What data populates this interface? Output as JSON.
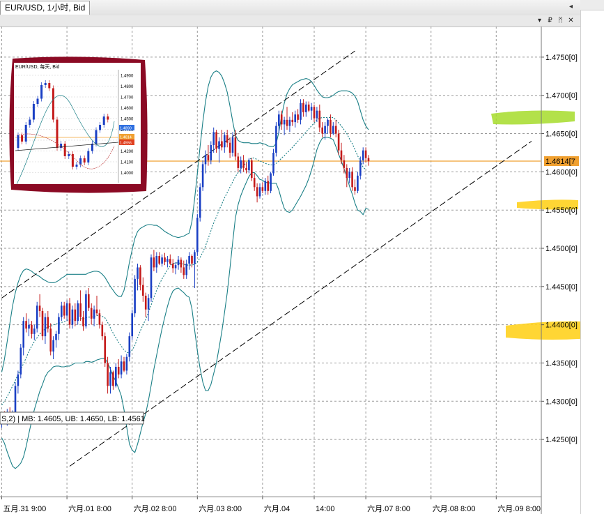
{
  "tab": {
    "title": "EUR/USD, 1小时, Bid"
  },
  "window_buttons": [
    "▾",
    "₽",
    "ᛗ",
    "✕"
  ],
  "indicator": {
    "text": "S,2) | MB: 1.4605, UB: 1.4650, LB: 1.4561"
  },
  "colors": {
    "bull": "#1a3fc4",
    "bear": "#c41a1a",
    "band": "#1a7f86",
    "channel": "#000000",
    "current_price_line": "#f0a030",
    "grid": "#9a9a9a",
    "highlight_green": "#a6dc2a",
    "highlight_yellow": "#ffd21e",
    "inset_frame": "#8b0a24"
  },
  "chart_data": {
    "type": "candlestick",
    "symbol": "EUR/USD",
    "timeframe": "1小时",
    "price_type": "Bid",
    "ylim": [
      1.4215,
      1.4775
    ],
    "y_ticks": [
      "1.4750[0]",
      "1.4700[0]",
      "1.4650[0]",
      "1.4600[0]",
      "1.4550[0]",
      "1.4500[0]",
      "1.4450[0]",
      "1.4400[0]",
      "1.4350[0]",
      "1.4300[0]",
      "1.4250[0]"
    ],
    "y_tick_values": [
      1.475,
      1.47,
      1.465,
      1.46,
      1.455,
      1.45,
      1.445,
      1.44,
      1.435,
      1.43,
      1.425
    ],
    "x_ticks": [
      {
        "label": "五月.31 9:00",
        "x": 0
      },
      {
        "label": "六月.01 8:00",
        "x": 24
      },
      {
        "label": "六月.02 8:00",
        "x": 48
      },
      {
        "label": "六月.03 8:00",
        "x": 72
      },
      {
        "label": "六月.04",
        "x": 96
      },
      {
        "label": "14:00",
        "x": 115
      },
      {
        "label": "六月.07 8:00",
        "x": 134
      },
      {
        "label": "六月.08 8:00",
        "x": 158
      },
      {
        "label": "六月.09 8:00",
        "x": 182
      }
    ],
    "current_price": 1.4614,
    "current_price_label": "1.4614[7",
    "candles": [
      [
        1.4276,
        1.4285,
        1.4265,
        1.428
      ],
      [
        1.428,
        1.4287,
        1.4272,
        1.4275
      ],
      [
        1.4275,
        1.429,
        1.4268,
        1.4285
      ],
      [
        1.4285,
        1.4292,
        1.4275,
        1.4278
      ],
      [
        1.4278,
        1.4288,
        1.427,
        1.4282
      ],
      [
        1.4282,
        1.4325,
        1.4278,
        1.432
      ],
      [
        1.432,
        1.434,
        1.431,
        1.4335
      ],
      [
        1.4335,
        1.4375,
        1.433,
        1.437
      ],
      [
        1.437,
        1.441,
        1.436,
        1.4405
      ],
      [
        1.4405,
        1.4415,
        1.439,
        1.4395
      ],
      [
        1.4395,
        1.4408,
        1.4385,
        1.44
      ],
      [
        1.44,
        1.4405,
        1.4382,
        1.4388
      ],
      [
        1.4388,
        1.44,
        1.438,
        1.4395
      ],
      [
        1.4395,
        1.443,
        1.439,
        1.4425
      ],
      [
        1.4425,
        1.444,
        1.441,
        1.4418
      ],
      [
        1.4418,
        1.4422,
        1.438,
        1.4385
      ],
      [
        1.4385,
        1.4415,
        1.4375,
        1.441
      ],
      [
        1.441,
        1.4418,
        1.439,
        1.4395
      ],
      [
        1.4395,
        1.4402,
        1.436,
        1.4365
      ],
      [
        1.4365,
        1.4385,
        1.4355,
        1.438
      ],
      [
        1.438,
        1.4392,
        1.437,
        1.4388
      ],
      [
        1.4388,
        1.4415,
        1.438,
        1.441
      ],
      [
        1.441,
        1.443,
        1.4405,
        1.4425
      ],
      [
        1.4425,
        1.443,
        1.4408,
        1.4412
      ],
      [
        1.4412,
        1.4432,
        1.4405,
        1.4428
      ],
      [
        1.4428,
        1.4435,
        1.4395,
        1.44
      ],
      [
        1.44,
        1.4425,
        1.4395,
        1.442
      ],
      [
        1.442,
        1.4428,
        1.4398,
        1.4405
      ],
      [
        1.4405,
        1.4432,
        1.44,
        1.4428
      ],
      [
        1.4428,
        1.4445,
        1.4405,
        1.441
      ],
      [
        1.441,
        1.4418,
        1.4392,
        1.4398
      ],
      [
        1.4398,
        1.4445,
        1.4395,
        1.444
      ],
      [
        1.444,
        1.4448,
        1.4418,
        1.4422
      ],
      [
        1.4422,
        1.4428,
        1.44,
        1.4408
      ],
      [
        1.4408,
        1.4425,
        1.4398,
        1.442
      ],
      [
        1.442,
        1.4438,
        1.4412,
        1.4415
      ],
      [
        1.4415,
        1.442,
        1.4395,
        1.44
      ],
      [
        1.44,
        1.4404,
        1.438,
        1.4385
      ],
      [
        1.4385,
        1.439,
        1.4345,
        1.435
      ],
      [
        1.435,
        1.4358,
        1.431,
        1.432
      ],
      [
        1.432,
        1.4345,
        1.431,
        1.4338
      ],
      [
        1.4338,
        1.434,
        1.4315,
        1.432
      ],
      [
        1.432,
        1.435,
        1.4318,
        1.4345
      ],
      [
        1.4345,
        1.4355,
        1.433,
        1.4335
      ],
      [
        1.4335,
        1.436,
        1.433,
        1.4352
      ],
      [
        1.4352,
        1.4358,
        1.4338,
        1.434
      ],
      [
        1.434,
        1.4362,
        1.4335,
        1.4358
      ],
      [
        1.4358,
        1.439,
        1.4352,
        1.4385
      ],
      [
        1.4385,
        1.442,
        1.438,
        1.4415
      ],
      [
        1.4415,
        1.4465,
        1.441,
        1.446
      ],
      [
        1.446,
        1.448,
        1.4445,
        1.4475
      ],
      [
        1.4475,
        1.4478,
        1.4445,
        1.4452
      ],
      [
        1.4452,
        1.4462,
        1.443,
        1.4438
      ],
      [
        1.4438,
        1.4442,
        1.441,
        1.442
      ],
      [
        1.442,
        1.444,
        1.4405,
        1.4435
      ],
      [
        1.4435,
        1.4492,
        1.443,
        1.4488
      ],
      [
        1.4488,
        1.4498,
        1.447,
        1.4475
      ],
      [
        1.4475,
        1.4495,
        1.4468,
        1.449
      ],
      [
        1.449,
        1.4495,
        1.4478,
        1.448
      ],
      [
        1.448,
        1.4492,
        1.4476,
        1.4488
      ],
      [
        1.4488,
        1.4494,
        1.4478,
        1.4482
      ],
      [
        1.4482,
        1.449,
        1.4475,
        1.4486
      ],
      [
        1.4486,
        1.4492,
        1.4478,
        1.448
      ],
      [
        1.448,
        1.4486,
        1.4468,
        1.4474
      ],
      [
        1.4474,
        1.4482,
        1.4466,
        1.4478
      ],
      [
        1.4478,
        1.449,
        1.4472,
        1.4485
      ],
      [
        1.4485,
        1.4488,
        1.4468,
        1.4475
      ],
      [
        1.4475,
        1.4484,
        1.446,
        1.4465
      ],
      [
        1.4465,
        1.4485,
        1.446,
        1.448
      ],
      [
        1.448,
        1.4495,
        1.4472,
        1.449
      ],
      [
        1.449,
        1.4492,
        1.4475,
        1.448
      ],
      [
        1.448,
        1.4498,
        1.4448,
        1.4495
      ],
      [
        1.4495,
        1.4545,
        1.449,
        1.454
      ],
      [
        1.454,
        1.4585,
        1.4535,
        1.458
      ],
      [
        1.458,
        1.4615,
        1.4575,
        1.461
      ],
      [
        1.461,
        1.4628,
        1.4598,
        1.4622
      ],
      [
        1.4622,
        1.4635,
        1.4608,
        1.4615
      ],
      [
        1.4615,
        1.464,
        1.461,
        1.4635
      ],
      [
        1.4635,
        1.4658,
        1.4625,
        1.4652
      ],
      [
        1.4652,
        1.4655,
        1.4625,
        1.463
      ],
      [
        1.463,
        1.4645,
        1.4612,
        1.464
      ],
      [
        1.464,
        1.4655,
        1.4628,
        1.4632
      ],
      [
        1.4632,
        1.4652,
        1.4625,
        1.4648
      ],
      [
        1.4648,
        1.4655,
        1.4632,
        1.4638
      ],
      [
        1.4638,
        1.4645,
        1.4618,
        1.4625
      ],
      [
        1.4625,
        1.4652,
        1.462,
        1.4645
      ],
      [
        1.4645,
        1.4655,
        1.4615,
        1.462
      ],
      [
        1.462,
        1.4625,
        1.46,
        1.4605
      ],
      [
        1.4605,
        1.462,
        1.4598,
        1.4615
      ],
      [
        1.4615,
        1.4622,
        1.46,
        1.4605
      ],
      [
        1.4605,
        1.4612,
        1.4598,
        1.4602
      ],
      [
        1.4602,
        1.4618,
        1.4598,
        1.4615
      ],
      [
        1.4615,
        1.4618,
        1.4588,
        1.4592
      ],
      [
        1.4592,
        1.4598,
        1.4575,
        1.458
      ],
      [
        1.458,
        1.4585,
        1.456,
        1.4568
      ],
      [
        1.4568,
        1.4585,
        1.4565,
        1.458
      ],
      [
        1.458,
        1.4586,
        1.4572,
        1.4575
      ],
      [
        1.4575,
        1.4592,
        1.457,
        1.4588
      ],
      [
        1.4588,
        1.4595,
        1.457,
        1.4575
      ],
      [
        1.4575,
        1.46,
        1.4572,
        1.4598
      ],
      [
        1.4598,
        1.463,
        1.4595,
        1.4625
      ],
      [
        1.4625,
        1.4665,
        1.462,
        1.466
      ],
      [
        1.466,
        1.468,
        1.465,
        1.4675
      ],
      [
        1.4675,
        1.468,
        1.4655,
        1.4662
      ],
      [
        1.4662,
        1.4672,
        1.4648,
        1.4668
      ],
      [
        1.4668,
        1.4685,
        1.4655,
        1.466
      ],
      [
        1.466,
        1.4672,
        1.4652,
        1.4668
      ],
      [
        1.4668,
        1.4678,
        1.466,
        1.4665
      ],
      [
        1.4665,
        1.468,
        1.4658,
        1.4675
      ],
      [
        1.4675,
        1.4682,
        1.4664,
        1.4668
      ],
      [
        1.4668,
        1.4695,
        1.4662,
        1.469
      ],
      [
        1.469,
        1.4695,
        1.4672,
        1.4678
      ],
      [
        1.4678,
        1.4692,
        1.4672,
        1.4688
      ],
      [
        1.4688,
        1.4692,
        1.4678,
        1.468
      ],
      [
        1.468,
        1.469,
        1.4668,
        1.4685
      ],
      [
        1.4685,
        1.4688,
        1.4665,
        1.467
      ],
      [
        1.467,
        1.4685,
        1.4665,
        1.468
      ],
      [
        1.468,
        1.4688,
        1.4652,
        1.4658
      ],
      [
        1.4658,
        1.4665,
        1.4645,
        1.465
      ],
      [
        1.465,
        1.4665,
        1.4642,
        1.466
      ],
      [
        1.466,
        1.467,
        1.465,
        1.4668
      ],
      [
        1.4668,
        1.4675,
        1.4645,
        1.465
      ],
      [
        1.465,
        1.4665,
        1.4648,
        1.466
      ],
      [
        1.466,
        1.4668,
        1.4645,
        1.465
      ],
      [
        1.465,
        1.4655,
        1.4622,
        1.4628
      ],
      [
        1.4628,
        1.4638,
        1.461,
        1.4615
      ],
      [
        1.4615,
        1.4622,
        1.4598,
        1.4605
      ],
      [
        1.4605,
        1.461,
        1.458,
        1.4592
      ],
      [
        1.4592,
        1.4605,
        1.4585,
        1.46
      ],
      [
        1.46,
        1.4606,
        1.4575,
        1.458
      ],
      [
        1.458,
        1.459,
        1.457,
        1.4575
      ],
      [
        1.4575,
        1.46,
        1.4572,
        1.4595
      ],
      [
        1.4595,
        1.462,
        1.459,
        1.4615
      ],
      [
        1.4615,
        1.4632,
        1.461,
        1.4628
      ],
      [
        1.4628,
        1.4632,
        1.4612,
        1.4618
      ],
      [
        1.4618,
        1.4622,
        1.4608,
        1.4614
      ]
    ],
    "bands": {
      "mid": [
        1.4295,
        1.43,
        1.4306,
        1.4313,
        1.432,
        1.4327,
        1.4335,
        1.4342,
        1.4349,
        1.4357,
        1.4365,
        1.4372,
        1.4378,
        1.4383,
        1.4388,
        1.4391,
        1.4395,
        1.4397,
        1.4398,
        1.44,
        1.4401,
        1.4402,
        1.4403,
        1.4404,
        1.4406,
        1.4406,
        1.4407,
        1.4408,
        1.4408,
        1.4408,
        1.4408,
        1.4409,
        1.441,
        1.441,
        1.4411,
        1.4412,
        1.4412,
        1.4411,
        1.4409,
        1.4403,
        1.4396,
        1.4389,
        1.4383,
        1.4377,
        1.4372,
        1.4367,
        1.4364,
        1.4363,
        1.4367,
        1.4373,
        1.4383,
        1.4392,
        1.44,
        1.4407,
        1.4416,
        1.4426,
        1.4436,
        1.4445,
        1.4453,
        1.446,
        1.4466,
        1.4472,
        1.4477,
        1.448,
        1.4481,
        1.4481,
        1.448,
        1.4479,
        1.4478,
        1.4478,
        1.4478,
        1.4479,
        1.4482,
        1.4488,
        1.4495,
        1.4503,
        1.4513,
        1.4523,
        1.4533,
        1.4541,
        1.455,
        1.4558,
        1.4566,
        1.4573,
        1.458,
        1.4587,
        1.4594,
        1.4599,
        1.4604,
        1.4608,
        1.4612,
        1.4616,
        1.4618,
        1.4618,
        1.4616,
        1.4614,
        1.4613,
        1.4611,
        1.461,
        1.4609,
        1.4609,
        1.4611,
        1.4614,
        1.4618,
        1.4621,
        1.4625,
        1.4628,
        1.4632,
        1.4636,
        1.464,
        1.4644,
        1.4648,
        1.4652,
        1.4656,
        1.466,
        1.4664,
        1.4668,
        1.467,
        1.4671,
        1.4671,
        1.4671,
        1.4671,
        1.4671,
        1.4668,
        1.4664,
        1.466,
        1.4655,
        1.465,
        1.4643,
        1.4637,
        1.4629,
        1.4621,
        1.4614,
        1.4606,
        1.4603
      ],
      "upper": [
        1.4338,
        1.4355,
        1.4378,
        1.4402,
        1.4425,
        1.4442,
        1.4455,
        1.4465,
        1.4471,
        1.4473,
        1.4472,
        1.447,
        1.4467,
        1.4465,
        1.4463,
        1.446,
        1.4458,
        1.4456,
        1.4455,
        1.4455,
        1.4456,
        1.4458,
        1.4461,
        1.4463,
        1.4466,
        1.4466,
        1.4466,
        1.4466,
        1.4466,
        1.4466,
        1.4466,
        1.4466,
        1.4468,
        1.4469,
        1.447,
        1.447,
        1.4469,
        1.4466,
        1.4462,
        1.4456,
        1.445,
        1.4445,
        1.444,
        1.4437,
        1.4437,
        1.4445,
        1.4462,
        1.4482,
        1.4498,
        1.4513,
        1.4522,
        1.4526,
        1.4528,
        1.453,
        1.4531,
        1.4531,
        1.453,
        1.453,
        1.4528,
        1.4525,
        1.4522,
        1.452,
        1.4518,
        1.4516,
        1.4515,
        1.4514,
        1.4515,
        1.4516,
        1.4518,
        1.452,
        1.4535,
        1.4565,
        1.4598,
        1.4633,
        1.4665,
        1.4692,
        1.4712,
        1.4724,
        1.473,
        1.4732,
        1.473,
        1.4725,
        1.4716,
        1.4704,
        1.4686,
        1.4666,
        1.4648,
        1.4641,
        1.4639,
        1.4638,
        1.4638,
        1.4638,
        1.4637,
        1.4637,
        1.4637,
        1.4638,
        1.4637,
        1.4636,
        1.4634,
        1.4633,
        1.4633,
        1.4637,
        1.4652,
        1.4673,
        1.469,
        1.4702,
        1.4709,
        1.4714,
        1.4716,
        1.4718,
        1.472,
        1.4721,
        1.4722,
        1.4721,
        1.4718,
        1.4713,
        1.4707,
        1.4702,
        1.4698,
        1.4697,
        1.4697,
        1.4698,
        1.47,
        1.4703,
        1.4705,
        1.4706,
        1.4706,
        1.4706,
        1.4705,
        1.4703,
        1.4699,
        1.4692,
        1.468,
        1.4668,
        1.466,
        1.4655
      ],
      "lower": [
        1.4252,
        1.4245,
        1.4234,
        1.4224,
        1.4215,
        1.4212,
        1.4215,
        1.4219,
        1.4227,
        1.4241,
        1.4258,
        1.4274,
        1.4289,
        1.4301,
        1.4313,
        1.4322,
        1.4332,
        1.4338,
        1.4341,
        1.4345,
        1.4346,
        1.4346,
        1.4345,
        1.4345,
        1.4346,
        1.4346,
        1.4348,
        1.435,
        1.435,
        1.435,
        1.435,
        1.4352,
        1.4352,
        1.4351,
        1.4352,
        1.4354,
        1.4355,
        1.4356,
        1.4356,
        1.435,
        1.4342,
        1.4333,
        1.4326,
        1.4317,
        1.4307,
        1.4289,
        1.4266,
        1.4244,
        1.4236,
        1.4233,
        1.4244,
        1.4258,
        1.4272,
        1.4284,
        1.4301,
        1.4321,
        1.4342,
        1.436,
        1.4378,
        1.4395,
        1.441,
        1.4424,
        1.4436,
        1.4444,
        1.4447,
        1.4448,
        1.4445,
        1.4442,
        1.4438,
        1.4436,
        1.4421,
        1.4393,
        1.4366,
        1.4343,
        1.4325,
        1.4314,
        1.4314,
        1.4322,
        1.4336,
        1.435,
        1.437,
        1.4391,
        1.4416,
        1.4442,
        1.4474,
        1.4508,
        1.454,
        1.4557,
        1.4569,
        1.4578,
        1.4586,
        1.4594,
        1.4599,
        1.4599,
        1.4595,
        1.459,
        1.4589,
        1.4586,
        1.4586,
        1.4585,
        1.4585,
        1.4585,
        1.4576,
        1.4563,
        1.4552,
        1.4548,
        1.4547,
        1.455,
        1.4556,
        1.4562,
        1.4568,
        1.4575,
        1.4582,
        1.4591,
        1.4602,
        1.4615,
        1.4629,
        1.4638,
        1.4644,
        1.4645,
        1.4645,
        1.4644,
        1.4642,
        1.4633,
        1.4623,
        1.4614,
        1.4604,
        1.4594,
        1.4581,
        1.4571,
        1.4559,
        1.455,
        1.4548,
        1.4544,
        1.4552,
        1.4551
      ]
    },
    "channel_lines": [
      [
        [
          0,
          1.4435
        ],
        [
          130,
          1.4758
        ]
      ],
      [
        [
          25,
          1.4215
        ],
        [
          195,
          1.464
        ]
      ]
    ],
    "inset": {
      "title": "EUR/USD, 每天, Bid",
      "y_ticks": [
        "1.4900",
        "1.4800",
        "1.4700",
        "1.4600",
        "1.4500",
        "1.4400",
        "1.4300",
        "1.4200",
        "1.4100",
        "1.4000"
      ],
      "price_labels": [
        "1.4890",
        "1.4614",
        "1.4556"
      ]
    }
  }
}
